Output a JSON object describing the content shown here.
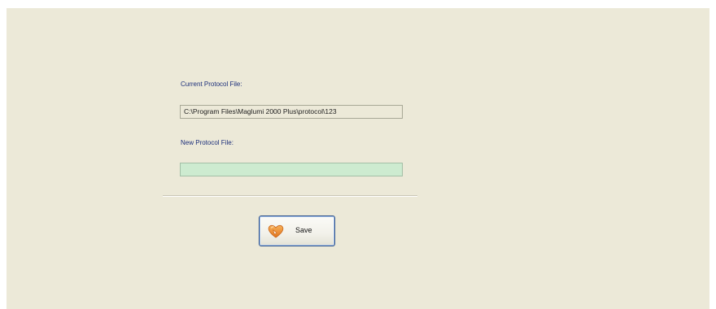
{
  "form": {
    "current_protocol_label": "Current Protocol File:",
    "current_protocol_value": "C:\\Program Files\\Maglumi 2000 Plus\\protocol\\123",
    "new_protocol_label": "New Protocol File:",
    "new_protocol_value": "",
    "save_label": "Save",
    "save_icon": "heart-icon"
  },
  "colors": {
    "panel_background": "#ece9d8",
    "label_text": "#1c2f7a",
    "new_field_background": "#cdebd0",
    "icon_orange": "#e8892d"
  }
}
